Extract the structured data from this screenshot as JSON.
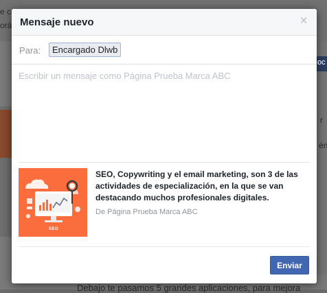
{
  "background": {
    "snippet_1": "e co",
    "snippet_2": "orá",
    "snippet_3": "Debajo te pasamos 5 grandes aplicaciones, para mejora",
    "right_button": "oc",
    "right_snippet_1": "r",
    "right_snippet_2": "én"
  },
  "dialog": {
    "title": "Mensaje nuevo",
    "close_glyph": "×",
    "to_label": "Para:",
    "recipient": "Encargado Dlwb",
    "message_placeholder": "Escribir un mensaje como Página Prueba Marca ABC",
    "message_value": "",
    "share": {
      "thumbnail_label": "SEO",
      "title": "SEO, Copywriting y el email marketing, son 3 de las actividades de especialización, en la que se van destacando muchos profesionales digitales.",
      "source": "De Página Prueba Marca ABC"
    },
    "send_label": "Enviar"
  },
  "colors": {
    "accent": "#4267b2",
    "thumbnail_bg": "#fb6d3d",
    "overlay": "#7a7a7a"
  }
}
